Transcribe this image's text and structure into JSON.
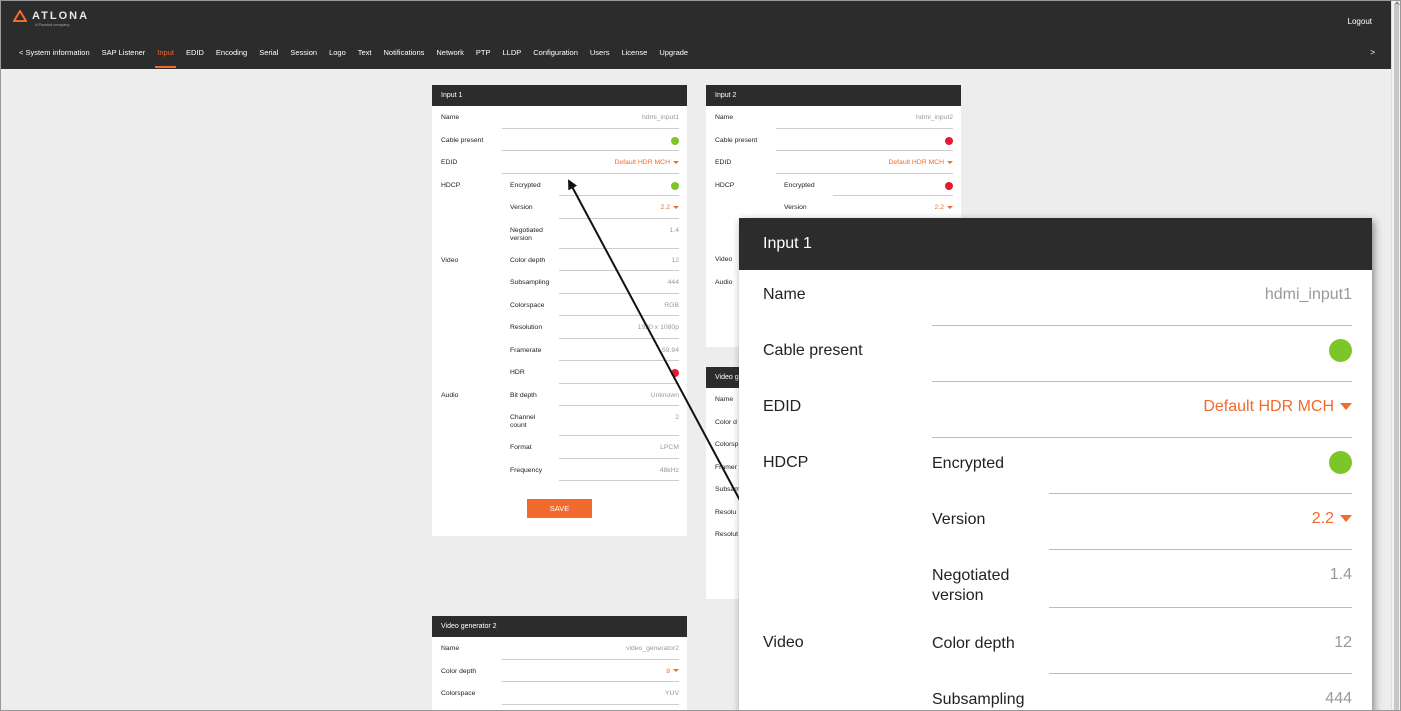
{
  "header": {
    "brand": "ATLONA",
    "brand_sub": "A Panduit company",
    "logout": "Logout",
    "nav_more": ">",
    "nav": [
      {
        "label": "<  System information"
      },
      {
        "label": "SAP Listener"
      },
      {
        "label": "Input"
      },
      {
        "label": "EDID"
      },
      {
        "label": "Encoding"
      },
      {
        "label": "Serial"
      },
      {
        "label": "Session"
      },
      {
        "label": "Logo"
      },
      {
        "label": "Text"
      },
      {
        "label": "Notifications"
      },
      {
        "label": "Network"
      },
      {
        "label": "PTP"
      },
      {
        "label": "LLDP"
      },
      {
        "label": "Configuration"
      },
      {
        "label": "Users"
      },
      {
        "label": "License"
      },
      {
        "label": "Upgrade"
      }
    ],
    "active_nav": "Input"
  },
  "input1": {
    "title": "Input 1",
    "name_label": "Name",
    "name_value": "hdmi_input1",
    "cable_label": "Cable present",
    "cable_status": "green",
    "edid_label": "EDID",
    "edid_value": "Default HDR MCH",
    "hdcp_label": "HDCP",
    "encrypted_label": "Encrypted",
    "encrypted_status": "green",
    "version_label": "Version",
    "version_value": "2.2",
    "negotiated_label": "Negotiated version",
    "negotiated_value": "1.4",
    "video_label": "Video",
    "color_depth_label": "Color depth",
    "color_depth_value": "12",
    "subsampling_label": "Subsampling",
    "subsampling_value": "444",
    "colorspace_label": "Colorspace",
    "colorspace_value": "RGB",
    "resolution_label": "Resolution",
    "resolution_value": "1920 x 1080p",
    "framerate_label": "Framerate",
    "framerate_value": "59.94",
    "hdr_label": "HDR",
    "hdr_status": "red",
    "audio_label": "Audio",
    "bit_depth_label": "Bit depth",
    "bit_depth_value": "Unknown",
    "channel_label": "Channel count",
    "channel_value": "2",
    "format_label": "Format",
    "format_value": "LPCM",
    "frequency_label": "Frequency",
    "frequency_value": "48kHz",
    "save": "SAVE"
  },
  "input2": {
    "title": "Input 2",
    "name_label": "Name",
    "name_value": "hdmi_input2",
    "cable_label": "Cable present",
    "cable_status": "red",
    "edid_label": "EDID",
    "edid_value": "Default HDR MCH",
    "hdcp_label": "HDCP",
    "encrypted_label": "Encrypted",
    "encrypted_status": "red",
    "version_label": "Version",
    "version_value": "2.2",
    "video_label": "Video",
    "audio_label": "Audio"
  },
  "videogen1": {
    "title": "Video g",
    "rows": [
      "Name",
      "Color d",
      "Colorsp",
      "Framer",
      "Subsam",
      "Resolu",
      "Resolut"
    ]
  },
  "videogen2": {
    "title": "Video generator 2",
    "name_label": "Name",
    "name_value": "video_generator2",
    "color_depth_label": "Color depth",
    "color_depth_value": "8",
    "colorspace_label": "Colorspace",
    "colorspace_value": "YUV"
  },
  "zoom": {
    "title": "Input 1",
    "name_label": "Name",
    "name_value": "hdmi_input1",
    "cable_label": "Cable present",
    "edid_label": "EDID",
    "edid_value": "Default HDR MCH",
    "hdcp_label": "HDCP",
    "encrypted_label": "Encrypted",
    "version_label": "Version",
    "version_value": "2.2",
    "negotiated_label": "Negotiated version",
    "negotiated_value": "1.4",
    "video_label": "Video",
    "color_depth_label": "Color depth",
    "color_depth_value": "12",
    "subsampling_label": "Subsampling",
    "subsampling_value": "444"
  },
  "colors": {
    "accent": "#f26a2e",
    "green": "#7dc62a",
    "red": "#e8182e",
    "header": "#2c2c2c"
  }
}
